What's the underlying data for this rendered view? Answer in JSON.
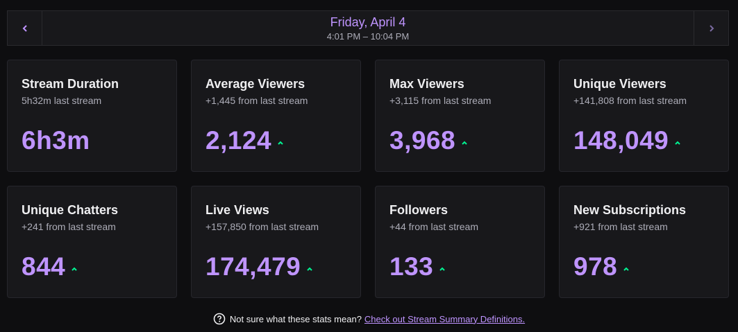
{
  "nav": {
    "prev_icon": "chevron-left-icon",
    "next_icon": "chevron-right-icon",
    "date": "Friday, April 4",
    "time_range": "4:01 PM – 10:04 PM"
  },
  "cards": [
    {
      "title": "Stream Duration",
      "sub": "5h32m last stream",
      "value": "6h3m",
      "trend": "none"
    },
    {
      "title": "Average Viewers",
      "sub": "+1,445 from last stream",
      "value": "2,124",
      "trend": "up"
    },
    {
      "title": "Max Viewers",
      "sub": "+3,115 from last stream",
      "value": "3,968",
      "trend": "up"
    },
    {
      "title": "Unique Viewers",
      "sub": "+141,808 from last stream",
      "value": "148,049",
      "trend": "up"
    },
    {
      "title": "Unique Chatters",
      "sub": "+241 from last stream",
      "value": "844",
      "trend": "up"
    },
    {
      "title": "Live Views",
      "sub": "+157,850 from last stream",
      "value": "174,479",
      "trend": "up"
    },
    {
      "title": "Followers",
      "sub": "+44 from last stream",
      "value": "133",
      "trend": "up"
    },
    {
      "title": "New Subscriptions",
      "sub": "+921 from last stream",
      "value": "978",
      "trend": "up"
    }
  ],
  "footer": {
    "question": "Not sure what these stats mean?",
    "link_text": "Check out Stream Summary Definitions."
  },
  "colors": {
    "accent": "#bf94ff",
    "trend_up": "#00f593",
    "background": "#0e0e10",
    "card": "#18181b"
  }
}
